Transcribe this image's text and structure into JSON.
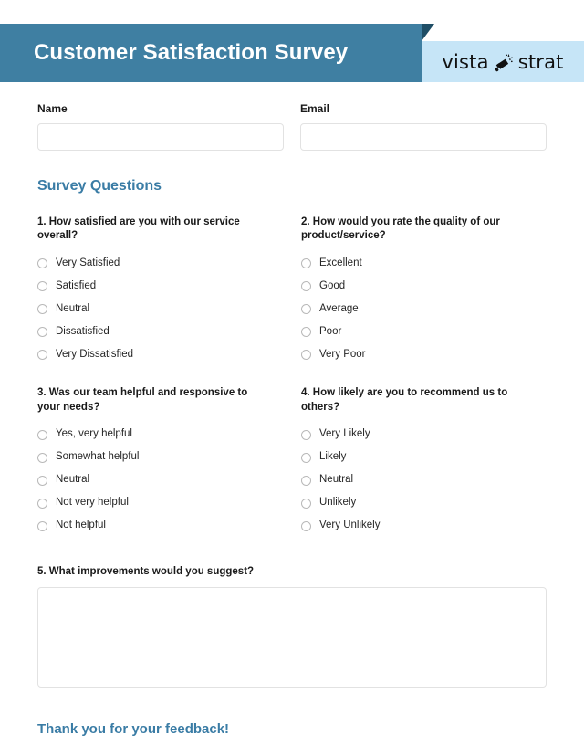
{
  "header": {
    "title": "Customer Satisfaction Survey",
    "brand": {
      "word_one": "vista",
      "word_two": "strat",
      "icon": "megaphone-icon"
    },
    "banner_color": "#3f7fa2",
    "fold_color": "#1f4e66",
    "logo_band_color": "#c6e5f7"
  },
  "form": {
    "name": {
      "label": "Name",
      "value": "",
      "placeholder": ""
    },
    "email": {
      "label": "Email",
      "value": "",
      "placeholder": ""
    }
  },
  "section": {
    "heading": "Survey Questions",
    "heading_color": "#3a7ca5"
  },
  "questions": [
    {
      "text": "1. How satisfied are you with our service overall?",
      "options": [
        "Very Satisfied",
        "Satisfied",
        "Neutral",
        "Dissatisfied",
        "Very Dissatisfied"
      ]
    },
    {
      "text": "2. How would you rate the quality of our product/service?",
      "options": [
        "Excellent",
        "Good",
        "Average",
        "Poor",
        "Very Poor"
      ]
    },
    {
      "text": "3. Was our team helpful and responsive to your needs?",
      "options": [
        "Yes, very helpful",
        "Somewhat helpful",
        "Neutral",
        "Not very helpful",
        "Not helpful"
      ]
    },
    {
      "text": "4. How likely are you to recommend us to others?",
      "options": [
        "Very Likely",
        "Likely",
        "Neutral",
        "Unlikely",
        "Very Unlikely"
      ]
    }
  ],
  "open_question": {
    "text": "5. What improvements would you suggest?",
    "value": "",
    "placeholder": ""
  },
  "footer": {
    "thanks": "Thank you for your feedback!",
    "color": "#3a7ca5"
  }
}
